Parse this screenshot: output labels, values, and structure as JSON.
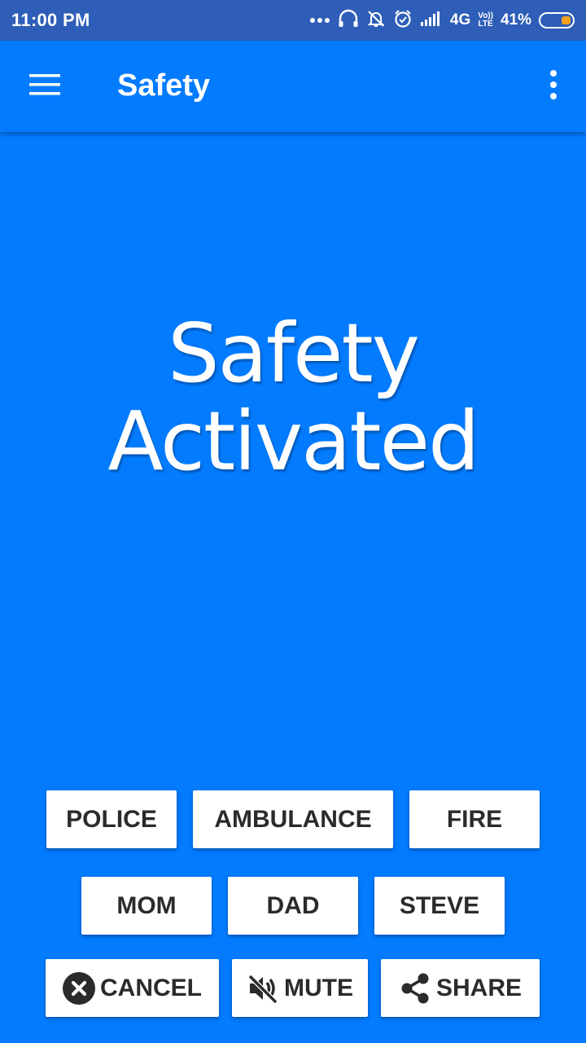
{
  "status_bar": {
    "time": "11:00 PM",
    "network": "4G",
    "volte_top": "Vo))",
    "volte_bottom": "LTE",
    "battery": "41%",
    "battery_level": 0.41,
    "icons": [
      "more-dots-icon",
      "headset-icon",
      "bell-off-icon",
      "alarm-icon",
      "signal-icon",
      "battery-icon"
    ]
  },
  "app_bar": {
    "title": "Safety",
    "icons": [
      "menu-icon",
      "overflow-menu-icon"
    ]
  },
  "hero": {
    "line1": "Safety",
    "line2": "Activated"
  },
  "contacts_row1": [
    "POLICE",
    "AMBULANCE",
    "FIRE"
  ],
  "contacts_row2": [
    "MOM",
    "DAD",
    "STEVE"
  ],
  "actions": {
    "cancel": "CANCEL",
    "mute": "MUTE",
    "share": "SHARE",
    "icons": [
      "cancel-icon",
      "volume-off-icon",
      "share-icon"
    ]
  },
  "colors": {
    "primary": "#027bff",
    "status_bar": "#2e5eb8",
    "button_bg": "#ffffff",
    "button_text": "#2b2b2b",
    "battery_fill": "#f2a21e"
  }
}
